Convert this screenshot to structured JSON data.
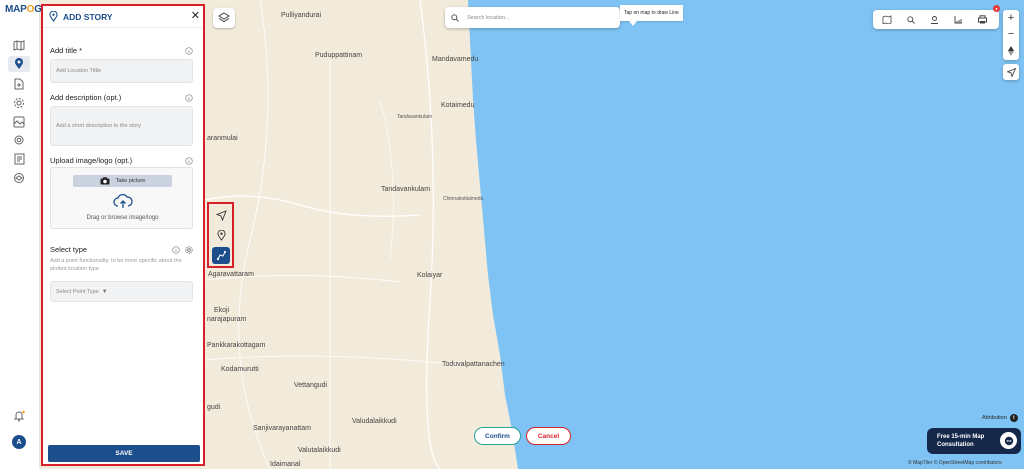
{
  "app": {
    "logo_main": "MAP",
    "logo_accent": "O",
    "logo_end": "G"
  },
  "rail": {
    "icons": [
      "map-icon",
      "location-pin-icon",
      "file-add-icon",
      "settings-gear-icon",
      "media-icon",
      "settings-cog-icon",
      "report-icon",
      "stack-share-icon"
    ],
    "bottom": [
      "notification-icon"
    ],
    "avatar_letter": "A"
  },
  "panel": {
    "title": "ADD STORY",
    "title_label": "Add title *",
    "title_placeholder": "Add Location Tittle",
    "description_label": "Add description (opt.)",
    "description_placeholder": "Add a short description to the story",
    "upload_label": "Upload image/logo (opt.)",
    "take_picture": "Take picture",
    "drag_text": "Drag or browse image/logo",
    "type_label": "Select type",
    "type_description": "Add a point functionality, to be more specific about the plotted location type",
    "type_placeholder": "Select Point Type",
    "save_label": "SAVE"
  },
  "map": {
    "search_placeholder": "Search location...",
    "tooltip": "Tap on map to draw Line",
    "confirm_label": "Confirm",
    "cancel_label": "Cancel",
    "attribution": "Attribution",
    "consult_line1": "Free 15-min Map",
    "consult_line2": "Consultation",
    "credit": "© MapTiler © OpenStreetMap contributors",
    "sea_color": "#7fc3f4",
    "land_color": "#f2ebdb",
    "accent_color": "#1c4e8c",
    "highlight_color": "#d6202a",
    "places": {
      "pulliyandurai": "Pulliyandurai",
      "puduppattinam": "Puduppattinam",
      "mandavamedu": "Mandavamedu",
      "kotaimedu": "Kotaimedu",
      "tandavankulam_small": "Tandavankulam",
      "aranmulai": "aranmulai",
      "tandavankulam": "Tandavankulam",
      "chinnakottaimedu": "Chinnakottaimedu",
      "agaravattaram": "Agaravattaram",
      "kolaiyar": "Kolaiyar",
      "ekoji": "Ekoji",
      "narajapuram": "narajapuram",
      "pankkarakottagam": "Pankkarakottagam",
      "toduvalpattanachen": "Toduvalpattanachen",
      "kodamurutti": "Kodamurutti",
      "vettangudi": "Vettangudi",
      "gudi": "gudi",
      "valudalaikkudi": "Valudalaikkudi",
      "sanjivarayanattam": "Sanjivarayanattam",
      "valutalaikkudi": "Valutalaikkudi",
      "idaimanal": "Idaimanal"
    }
  }
}
